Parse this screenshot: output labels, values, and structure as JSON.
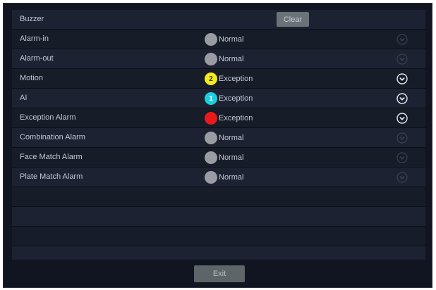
{
  "buzzer": {
    "label": "Buzzer",
    "clear_label": "Clear"
  },
  "alarms": [
    {
      "name": "Alarm-in",
      "status": "Normal",
      "count": "",
      "dot_color": "#9a9ca3",
      "expandable": false
    },
    {
      "name": "Alarm-out",
      "status": "Normal",
      "count": "",
      "dot_color": "#9a9ca3",
      "expandable": false
    },
    {
      "name": "Motion",
      "status": "Exception",
      "count": "2",
      "dot_color": "#f2ea1c",
      "expandable": true
    },
    {
      "name": "AI",
      "status": "Exception",
      "count": "1",
      "dot_color": "#1ccde0",
      "expandable": true
    },
    {
      "name": "Exception Alarm",
      "status": "Exception",
      "count": "",
      "dot_color": "#e71b1b",
      "expandable": true
    },
    {
      "name": "Combination Alarm",
      "status": "Normal",
      "count": "",
      "dot_color": "#9a9ca3",
      "expandable": false
    },
    {
      "name": "Face Match Alarm",
      "status": "Normal",
      "count": "",
      "dot_color": "#9a9ca3",
      "expandable": false
    },
    {
      "name": "Plate Match Alarm",
      "status": "Normal",
      "count": "",
      "dot_color": "#9a9ca3",
      "expandable": false
    }
  ],
  "footer": {
    "exit_label": "Exit"
  },
  "icons": {
    "expand": "chevron-down-circle-icon"
  },
  "colors": {
    "background": "#111521",
    "panel": "#181d2b",
    "button": "#6b7278"
  }
}
